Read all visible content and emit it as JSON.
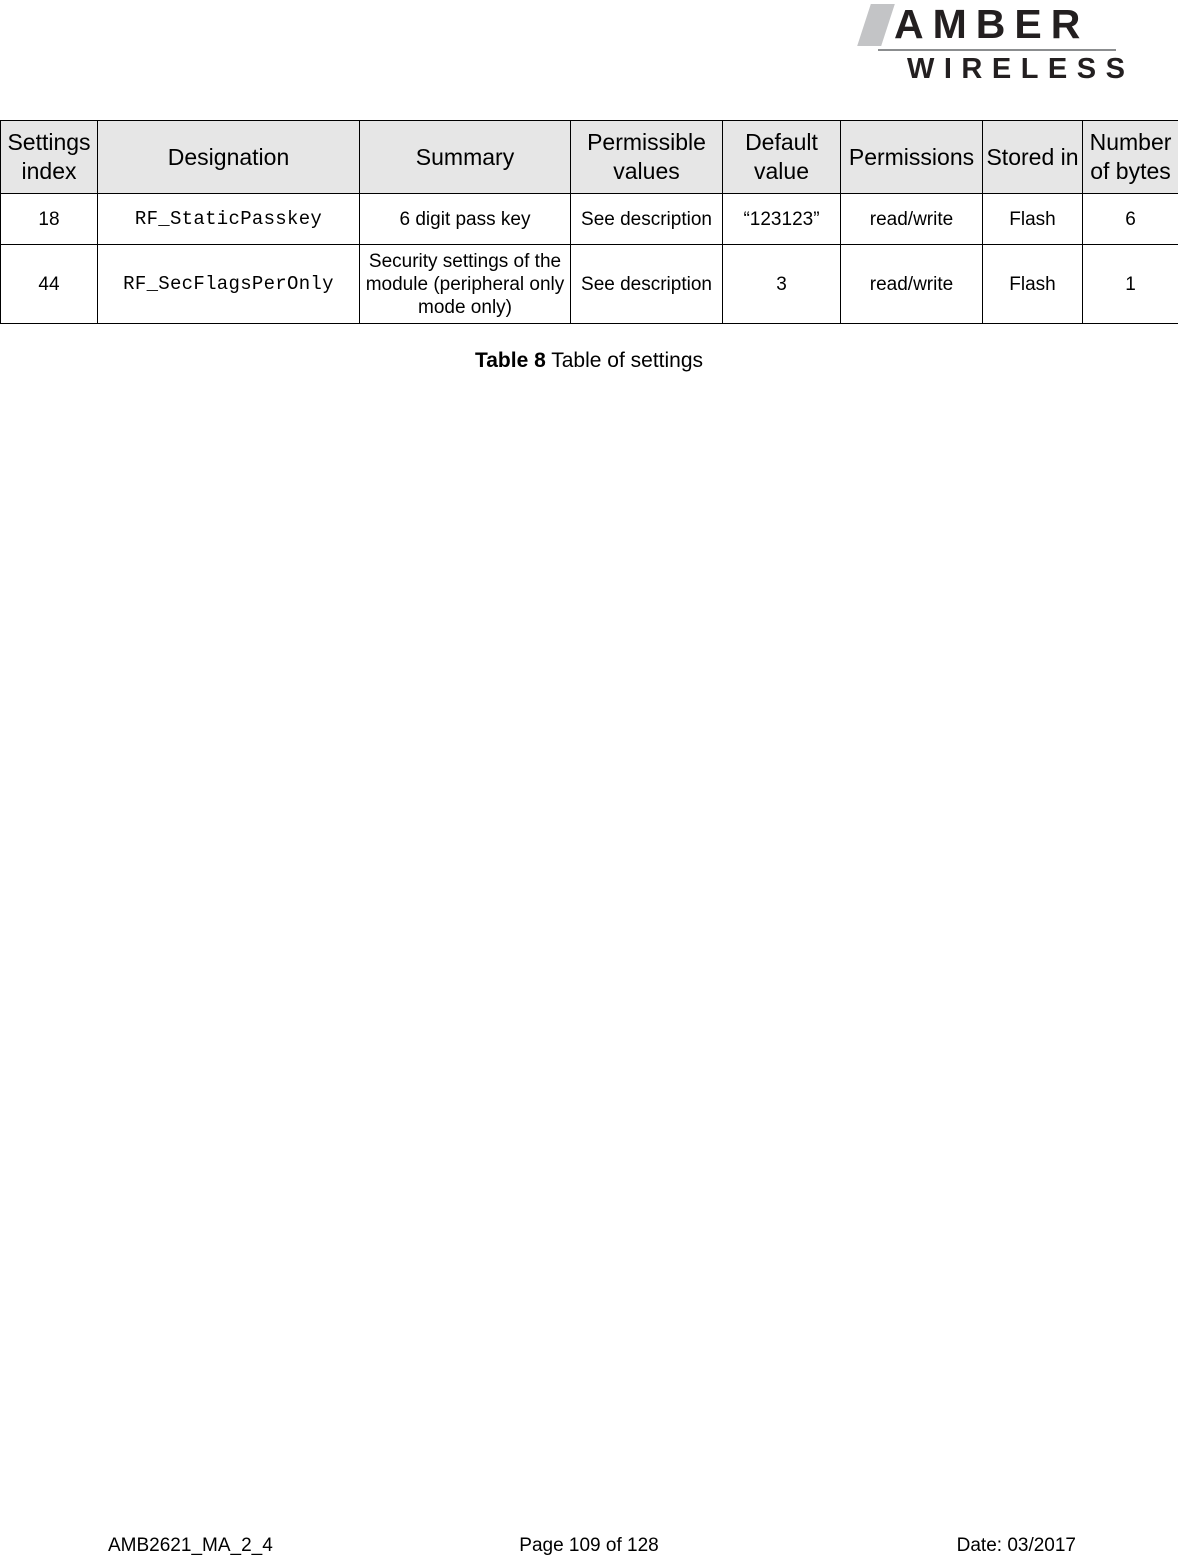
{
  "header": {
    "logo": {
      "brand_primary": "AMBER",
      "brand_secondary": "WIRELESS",
      "slash_color": "#c3c4c6",
      "text_color": "#231f20",
      "rule_color": "#8b8d8f"
    }
  },
  "table": {
    "header_bg": "#e6e6e6",
    "border_color": "#000000",
    "columns": [
      "Settings index",
      "Designation",
      "Summary",
      "Permissible values",
      "Default value",
      "Permissions",
      "Stored in",
      "Number of bytes"
    ],
    "rows": [
      {
        "index": "18",
        "designation": "RF_StaticPasskey",
        "summary": "6 digit pass key",
        "permissible_values": "See description",
        "default_value": "“123123”",
        "permissions": "read/write",
        "stored_in": "Flash",
        "number_of_bytes": "6"
      },
      {
        "index": "44",
        "designation": "RF_SecFlagsPerOnly",
        "summary": "Security settings of the module (peripheral only mode only)",
        "permissible_values": "See description",
        "default_value": "3",
        "permissions": "read/write",
        "stored_in": "Flash",
        "number_of_bytes": "1"
      }
    ]
  },
  "caption": {
    "label": "Table 8",
    "text": " Table of settings"
  },
  "footer": {
    "left": "AMB2621_MA_2_4",
    "center": "Page 109 of 128",
    "right": "Date: 03/2017"
  }
}
